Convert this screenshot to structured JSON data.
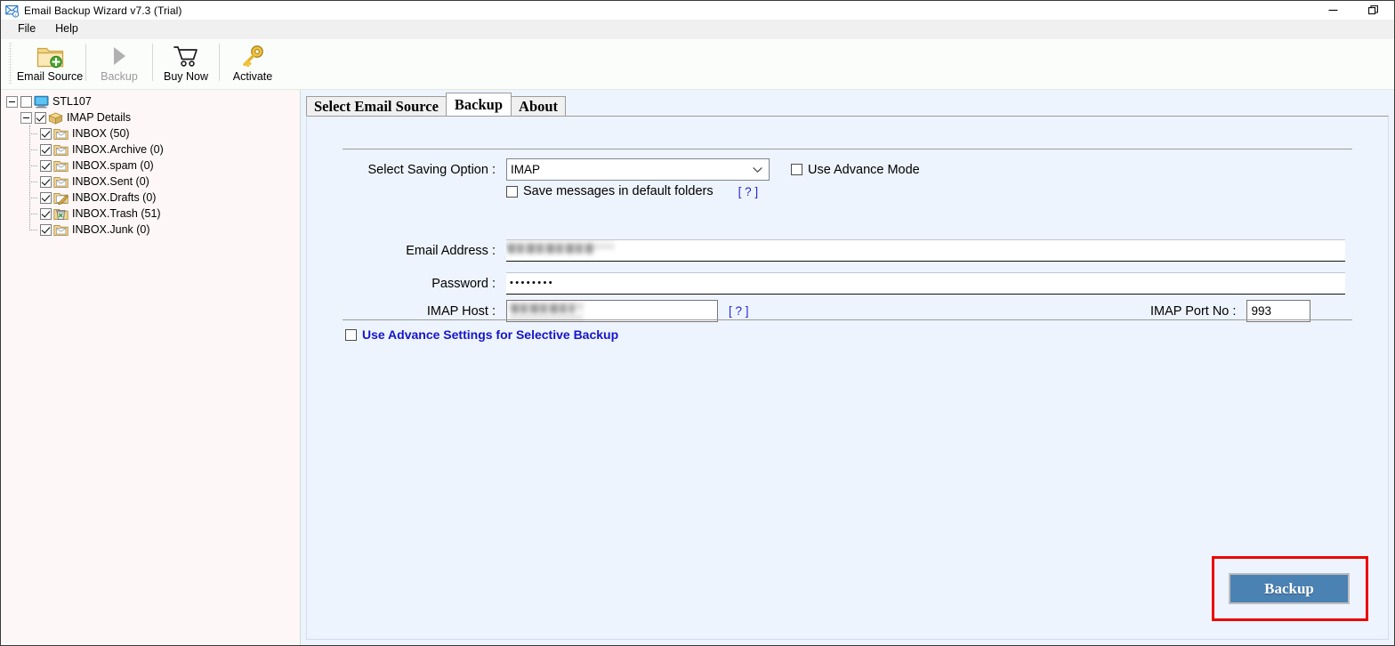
{
  "window": {
    "title": "Email Backup Wizard v7.3 (Trial)",
    "icon": "envelope-icon",
    "controls": [
      {
        "name": "minimize-button",
        "glyph": "minimize-icon"
      },
      {
        "name": "restore-button",
        "glyph": "restore-icon"
      }
    ]
  },
  "menubar": {
    "items": [
      {
        "label": "File",
        "name": "menu-file"
      },
      {
        "label": "Help",
        "name": "menu-help"
      }
    ]
  },
  "toolbar": {
    "buttons": [
      {
        "label": "Email Source",
        "icon": "folder-add-icon",
        "name": "toolbar-email-source",
        "disabled": false
      },
      {
        "label": "Backup",
        "icon": "play-icon",
        "name": "toolbar-backup",
        "disabled": true
      },
      {
        "label": "Buy Now",
        "icon": "cart-icon",
        "name": "toolbar-buy-now",
        "disabled": false
      },
      {
        "label": "Activate",
        "icon": "key-icon",
        "name": "toolbar-activate",
        "disabled": false
      }
    ]
  },
  "tree": {
    "root": {
      "label": "STL107",
      "icon": "computer-icon",
      "checked": false,
      "expanded": true
    },
    "parent": {
      "label": "IMAP Details",
      "icon": "package-icon",
      "checked": true,
      "expanded": true
    },
    "folders": [
      {
        "label": "INBOX (50)",
        "icon": "mail-folder-icon",
        "checked": true
      },
      {
        "label": "INBOX.Archive (0)",
        "icon": "mail-folder-icon",
        "checked": true
      },
      {
        "label": "INBOX.spam (0)",
        "icon": "mail-folder-icon",
        "checked": true
      },
      {
        "label": "INBOX.Sent (0)",
        "icon": "mail-folder-icon",
        "checked": true
      },
      {
        "label": "INBOX.Drafts (0)",
        "icon": "drafts-folder-icon",
        "checked": true
      },
      {
        "label": "INBOX.Trash (51)",
        "icon": "trash-folder-icon",
        "checked": true
      },
      {
        "label": "INBOX.Junk (0)",
        "icon": "mail-folder-icon",
        "checked": true
      }
    ]
  },
  "tabs": [
    {
      "label": "Select Email Source",
      "name": "tab-select-email-source",
      "active": false
    },
    {
      "label": "Backup",
      "name": "tab-backup",
      "active": true
    },
    {
      "label": "About",
      "name": "tab-about",
      "active": false
    }
  ],
  "form": {
    "saving_option": {
      "label": "Select Saving Option :",
      "value": "IMAP",
      "options": [
        "IMAP"
      ]
    },
    "use_advance_mode": {
      "label": "Use Advance Mode",
      "checked": false
    },
    "save_default_folders": {
      "label": "Save messages in default folders",
      "checked": false
    },
    "save_default_folders_help": "[ ? ]",
    "email_address": {
      "label": "Email Address :",
      "value": "",
      "redacted": true
    },
    "password": {
      "label": "Password :",
      "value": "••••••••",
      "masked": true
    },
    "imap_host": {
      "label": "IMAP Host :",
      "value": "",
      "redacted": true
    },
    "imap_host_help": "[ ? ]",
    "imap_port": {
      "label": "IMAP Port No :",
      "value": "993"
    },
    "use_advance_settings": {
      "label": "Use Advance Settings for Selective Backup",
      "checked": false,
      "color": "#1515c8"
    }
  },
  "actions": {
    "backup_button": {
      "label": "Backup",
      "name": "backup-button",
      "color": "#4b82b4"
    },
    "highlight_color": "#ee0000"
  }
}
